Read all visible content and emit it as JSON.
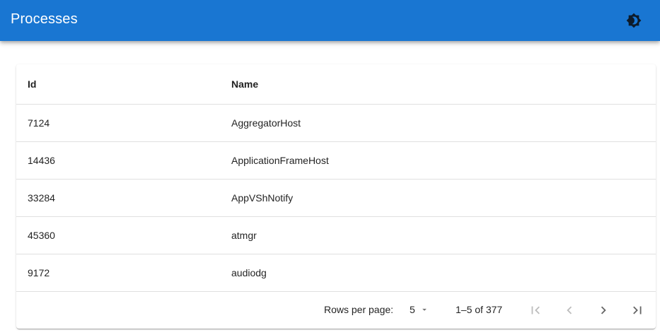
{
  "appbar": {
    "title": "Processes",
    "theme_toggle_icon": "brightness-icon",
    "color": "#1976d2"
  },
  "table": {
    "columns": [
      "Id",
      "Name"
    ],
    "rows": [
      {
        "id": "7124",
        "name": "AggregatorHost"
      },
      {
        "id": "14436",
        "name": "ApplicationFrameHost"
      },
      {
        "id": "33284",
        "name": "AppVShNotify"
      },
      {
        "id": "45360",
        "name": "atmgr"
      },
      {
        "id": "9172",
        "name": "audiodg"
      }
    ]
  },
  "pagination": {
    "rows_per_page_label": "Rows per page:",
    "rows_per_page_value": "5",
    "range_text": "1–5 of 377",
    "icons": [
      "first-page-icon",
      "previous-page-icon",
      "next-page-icon",
      "last-page-icon"
    ]
  }
}
